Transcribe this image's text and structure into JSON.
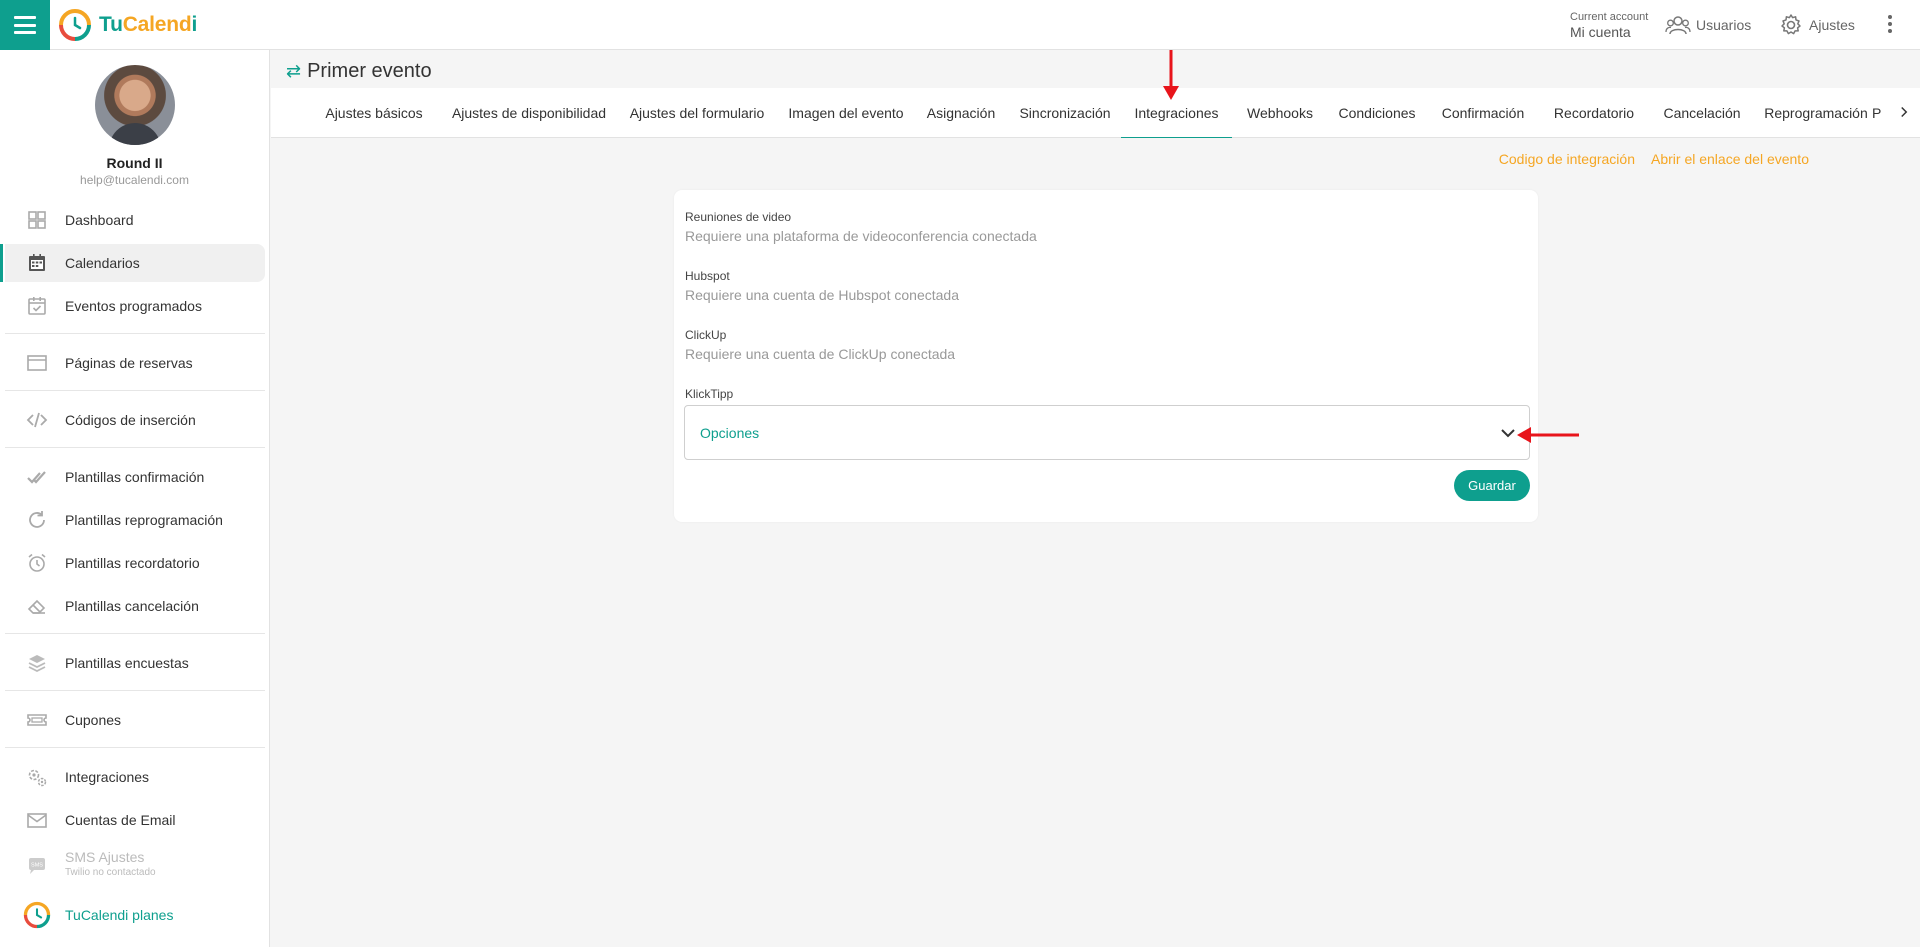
{
  "brand": {
    "part1": "Tu",
    "part2": "Calend",
    "part3": "i"
  },
  "topbar": {
    "account_small": "Current account",
    "account_name": "Mi cuenta",
    "users_label": "Usuarios",
    "settings_label": "Ajustes"
  },
  "profile": {
    "name": "Round II",
    "email": "help@tucalendi.com"
  },
  "sidebar": {
    "items": [
      {
        "label": "Dashboard"
      },
      {
        "label": "Calendarios"
      },
      {
        "label": "Eventos programados"
      },
      {
        "label": "Páginas de reservas"
      },
      {
        "label": "Códigos de inserción"
      },
      {
        "label": "Plantillas confirmación"
      },
      {
        "label": "Plantillas reprogramación"
      },
      {
        "label": "Plantillas recordatorio"
      },
      {
        "label": "Plantillas cancelación"
      },
      {
        "label": "Plantillas encuestas"
      },
      {
        "label": "Cupones"
      },
      {
        "label": "Integraciones"
      },
      {
        "label": "Cuentas de Email"
      },
      {
        "label": "SMS Ajustes",
        "sub": "Twilio no contactado"
      },
      {
        "label": "TuCalendi planes"
      }
    ],
    "active_index": 1
  },
  "event": {
    "title": "Primer evento"
  },
  "tabs": [
    "Ajustes básicos",
    "Ajustes de disponibilidad",
    "Ajustes del formulario",
    "Imagen del evento",
    "Asignación",
    "Sincronización",
    "Integraciones",
    "Webhooks",
    "Condiciones",
    "Confirmación",
    "Recordatorio",
    "Cancelación",
    "Reprogramación",
    "P"
  ],
  "active_tab": "Integraciones",
  "links": {
    "integration_code": "Codigo de integración",
    "open_link": "Abrir el enlace del evento"
  },
  "form": {
    "video": {
      "label": "Reuniones de video",
      "help": "Requiere una plataforma de videoconferencia conectada"
    },
    "hubspot": {
      "label": "Hubspot",
      "help": "Requiere una cuenta de Hubspot conectada"
    },
    "clickup": {
      "label": "ClickUp",
      "help": "Requiere una cuenta de ClickUp conectada"
    },
    "klicktipp": {
      "label": "KlickTipp",
      "selected": "Opciones"
    },
    "save_label": "Guardar"
  },
  "colors": {
    "accent": "#0e9f8e",
    "brand_orange": "#f5a623",
    "annotation": "#e8141b"
  }
}
